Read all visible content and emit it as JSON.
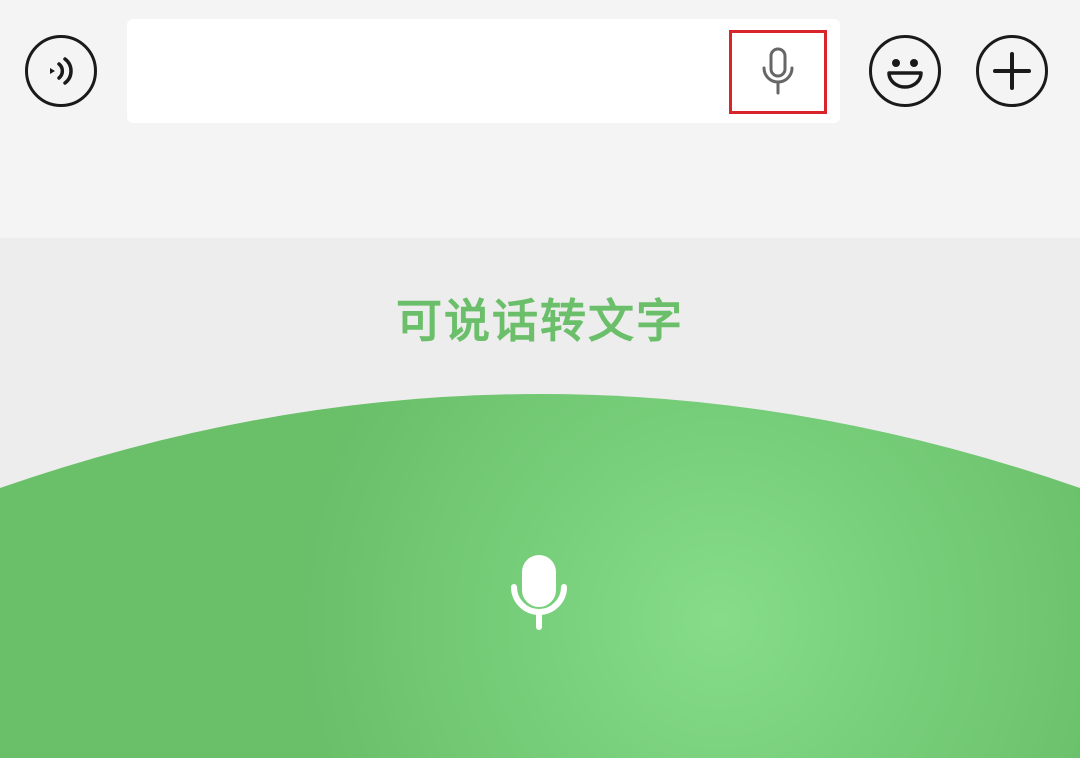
{
  "input": {
    "value": ""
  },
  "voice_panel": {
    "hint": "可说话转文字"
  },
  "icons": {
    "voice_toggle": "speaker-waves-icon",
    "input_mic": "microphone-icon",
    "emoji": "smiley-face-icon",
    "plus": "plus-icon",
    "panel_mic": "microphone-icon"
  },
  "colors": {
    "accent_green": "#6cbf6a",
    "panel_green": "#6abf69",
    "panel_glow": "#86dc89",
    "highlight_red": "#d9242b",
    "toolbar_bg": "#f4f4f4",
    "panel_bg": "#ededed"
  }
}
